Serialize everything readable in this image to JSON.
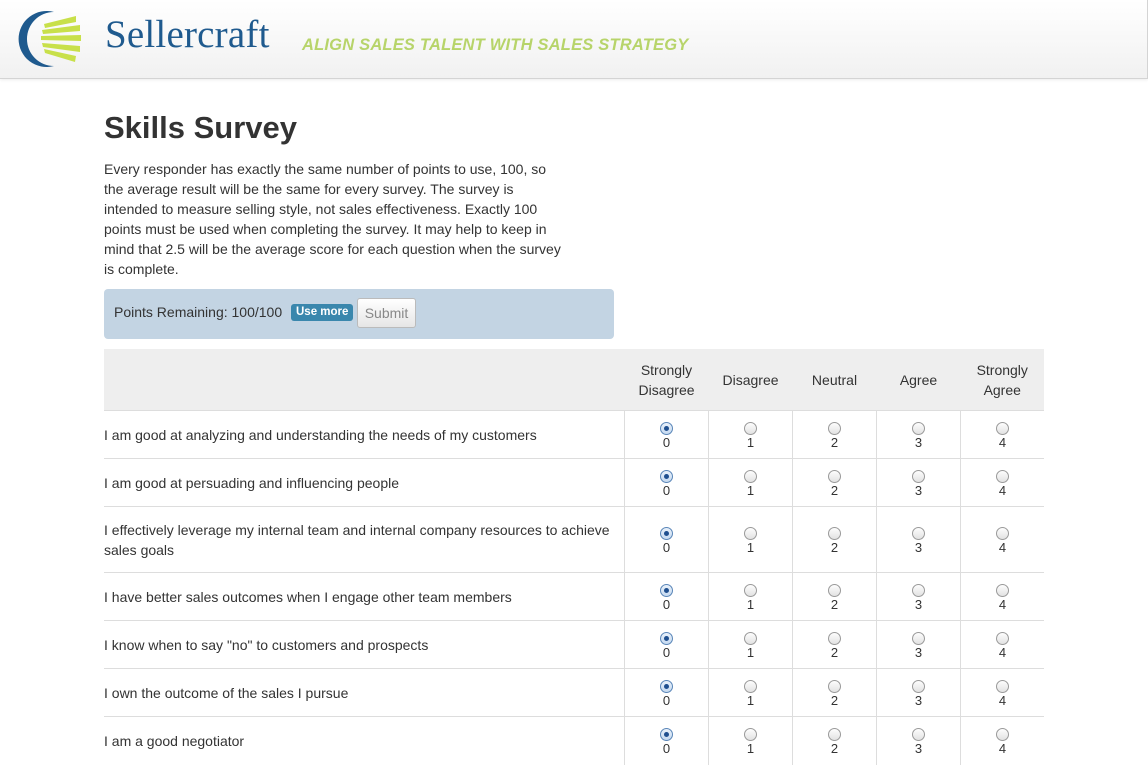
{
  "header": {
    "brand": "Sellercraft",
    "tagline": "ALIGN SALES TALENT WITH SALES STRATEGY",
    "logo_icon": "sellercraft-logo-icon"
  },
  "page": {
    "title": "Skills Survey",
    "intro": "Every responder has exactly the same number of points to use, 100, so the average result will be the same for every survey. The survey is intended to measure selling style, not sales effectiveness. Exactly 100 points must be used when completing the survey. It may help to keep in mind that 2.5 will be the average score for each question when the survey is complete."
  },
  "points": {
    "label": "Points Remaining: 100/100",
    "badge": "Use more",
    "submit_label": "Submit"
  },
  "survey": {
    "columns": [
      "Strongly\nDisagree",
      "Disagree",
      "Neutral",
      "Agree",
      "Strongly\nAgree"
    ],
    "values": [
      "0",
      "1",
      "2",
      "3",
      "4"
    ],
    "rows": [
      {
        "question": "I am good at analyzing and understanding the needs of my customers",
        "selected": 0
      },
      {
        "question": "I am good at persuading and influencing people",
        "selected": 0
      },
      {
        "question": "I effectively leverage my internal team and internal company resources to achieve sales goals",
        "selected": 0
      },
      {
        "question": "I have better sales outcomes when I engage other team members",
        "selected": 0
      },
      {
        "question": "I know when to say \"no\" to customers and prospects",
        "selected": 0
      },
      {
        "question": "I own the outcome of the sales I pursue",
        "selected": 0
      },
      {
        "question": "I am a good negotiator",
        "selected": 0
      }
    ]
  },
  "colors": {
    "brand": "#1f5a8e",
    "tagline": "#b7d46a",
    "points_box": "#c3d4e3",
    "badge": "#3a87ad"
  }
}
